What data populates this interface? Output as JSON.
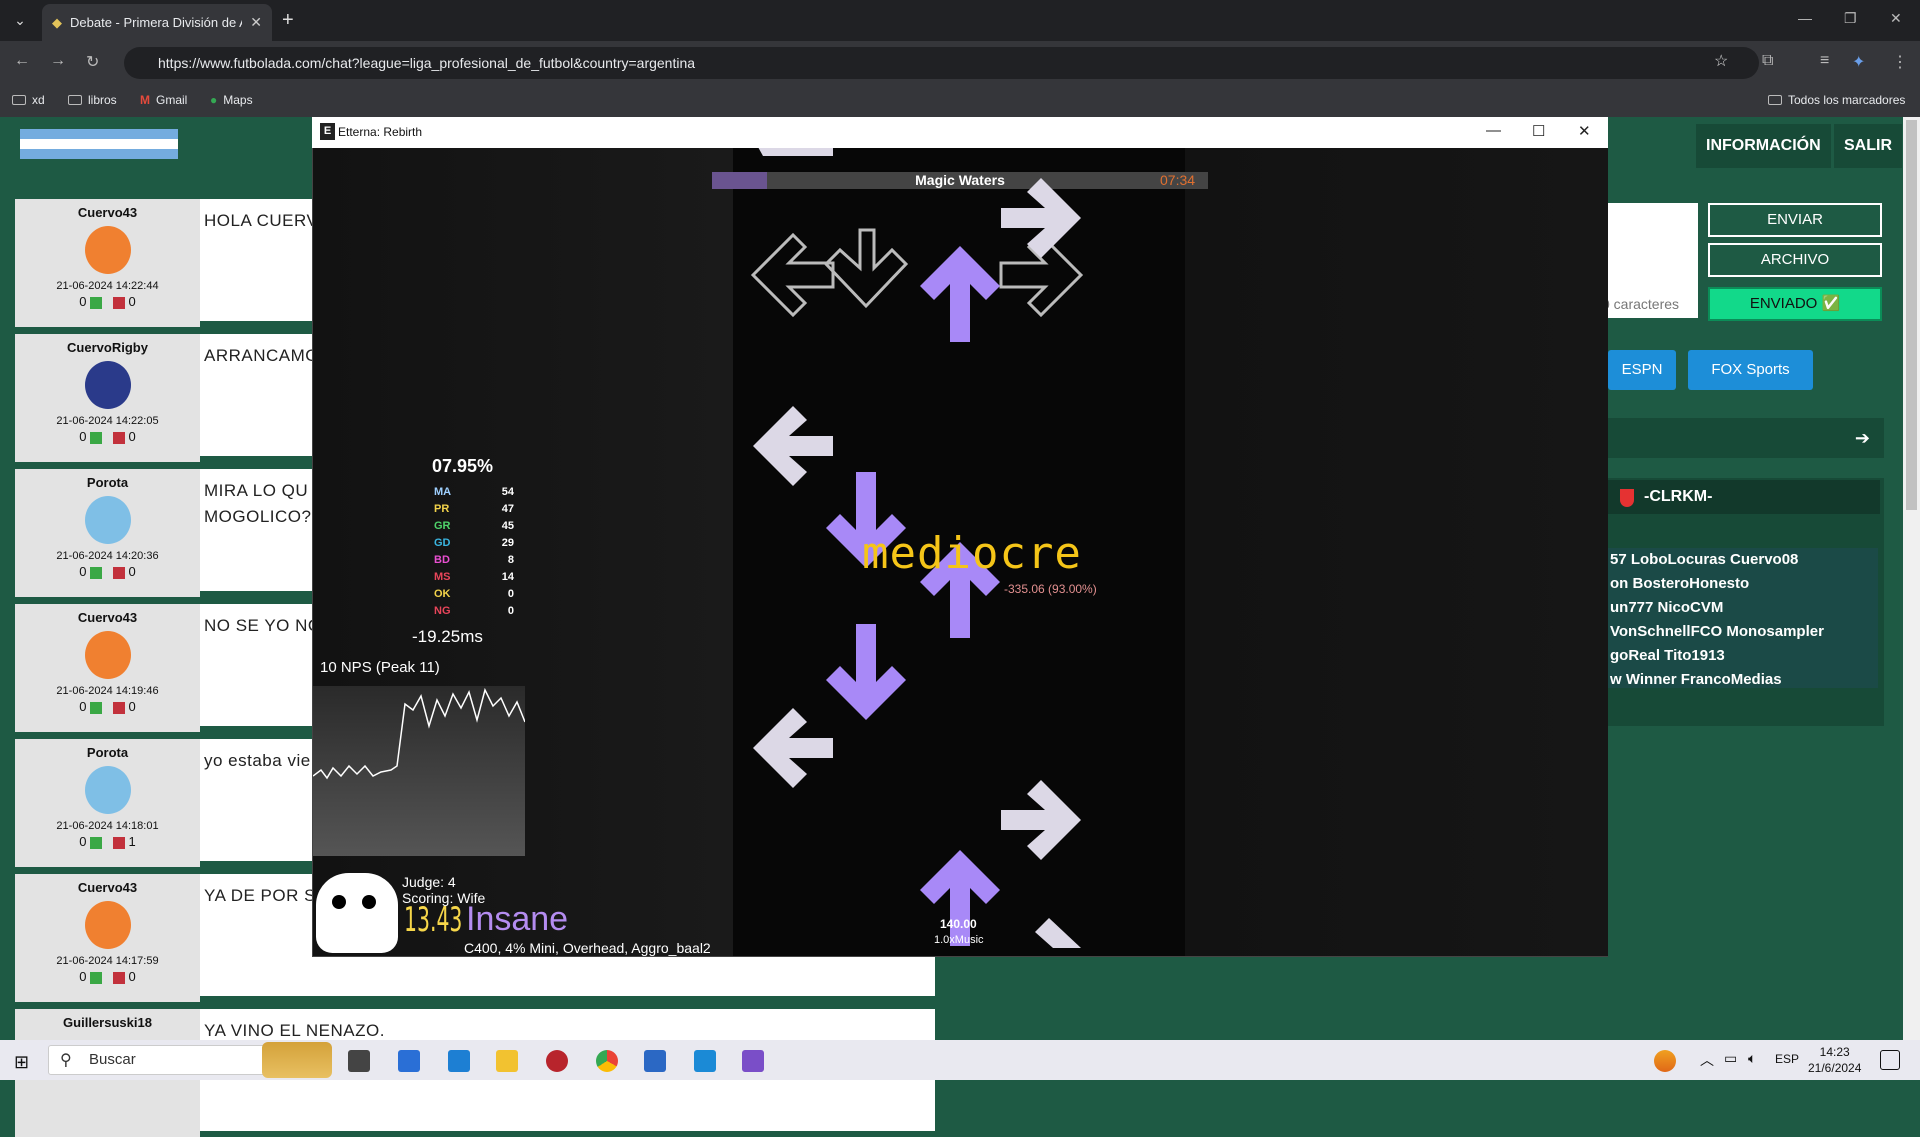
{
  "browser": {
    "tab_title": "Debate - Primera División de Ar",
    "url": "https://www.futbolada.com/chat?league=liga_profesional_de_futbol&country=argentina",
    "bookmarks": [
      "xd",
      "libros",
      "Gmail",
      "Maps"
    ],
    "all_bookmarks": "Todos los marcadores"
  },
  "site": {
    "nav": {
      "info": "INFORMACIÓN",
      "logout": "SALIR"
    },
    "buttons": {
      "send": "ENVIAR",
      "file": "ARCHIVO",
      "sent": "ENVIADO ✅"
    },
    "char_count": "0 caracteres",
    "tv": {
      "espn": "ESPN",
      "fox": "FOX Sports"
    },
    "online_header": "-CLRKM-",
    "online_users": [
      "57  LoboLocuras  Cuervo08",
      "on  BosteroHonesto",
      "un777  NicoCVM",
      "VonSchnellFCO  Monosampler",
      "goReal  Tito1913",
      "w  Winner  FrancoMedias"
    ],
    "posts": [
      {
        "user": "Cuervo43",
        "date": "21-06-2024 14:22:44",
        "up": "0",
        "down": "0",
        "msg": "HOLA CUERV",
        "color": "#f08030"
      },
      {
        "user": "CuervoRigby",
        "date": "21-06-2024 14:22:05",
        "up": "0",
        "down": "0",
        "msg": "ARRANCAMO",
        "color": "#2a3a8a"
      },
      {
        "user": "Porota",
        "date": "21-06-2024 14:20:36",
        "up": "0",
        "down": "0",
        "msg": "MIRA LO QU",
        "msg2": "MOGOLICO?",
        "color": "#7fbfe6"
      },
      {
        "user": "Cuervo43",
        "date": "21-06-2024 14:19:46",
        "up": "0",
        "down": "0",
        "msg": "NO SE YO NO",
        "color": "#f08030"
      },
      {
        "user": "Porota",
        "date": "21-06-2024 14:18:01",
        "up": "0",
        "down": "1",
        "msg": "yo estaba vie",
        "color": "#7fbfe6"
      },
      {
        "user": "Cuervo43",
        "date": "21-06-2024 14:17:59",
        "up": "0",
        "down": "0",
        "msg": "YA DE POR S",
        "color": "#f08030"
      },
      {
        "user": "Guillersuski18",
        "msg": "YA VINO EL NENAZO."
      }
    ]
  },
  "game": {
    "window_title": "Etterna: Rebirth",
    "song_title": "Magic Waters",
    "song_time": "07:34",
    "song_progress": 0.11,
    "accuracy": "07.95%",
    "judgments": [
      {
        "label": "MA",
        "count": "54",
        "color": "#9fd0ff"
      },
      {
        "label": "PR",
        "count": "47",
        "color": "#f2d24a"
      },
      {
        "label": "GR",
        "count": "45",
        "color": "#4fd36a"
      },
      {
        "label": "GD",
        "count": "29",
        "color": "#3ab5e0"
      },
      {
        "label": "BD",
        "count": "8",
        "color": "#e84fd0"
      },
      {
        "label": "MS",
        "count": "14",
        "color": "#e8455a"
      },
      {
        "label": "OK",
        "count": "0",
        "color": "#f2d24a"
      },
      {
        "label": "NG",
        "count": "0",
        "color": "#e8455a"
      }
    ],
    "offset": "-19.25ms",
    "nps": "10 NPS (Peak 11)",
    "judge": "Judge: 4",
    "scoring": "Scoring: Wife",
    "difficulty_number": "13.43",
    "difficulty_name": "Insane",
    "mods": "C400, 4% Mini, Overhead, Aggro_baal2",
    "bpm": "140.00",
    "rate": "1.0xMusic",
    "judgment_text": "mediocre",
    "error_text": "-335.06 (93.00%)"
  },
  "taskbar": {
    "search": "Buscar",
    "lang": "ESP",
    "time": "14:23",
    "date": "21/6/2024"
  },
  "colors": {
    "site_green": "#1e5a44",
    "arrow_purple": "#a889f7",
    "arrow_white": "#dcd8e6"
  }
}
